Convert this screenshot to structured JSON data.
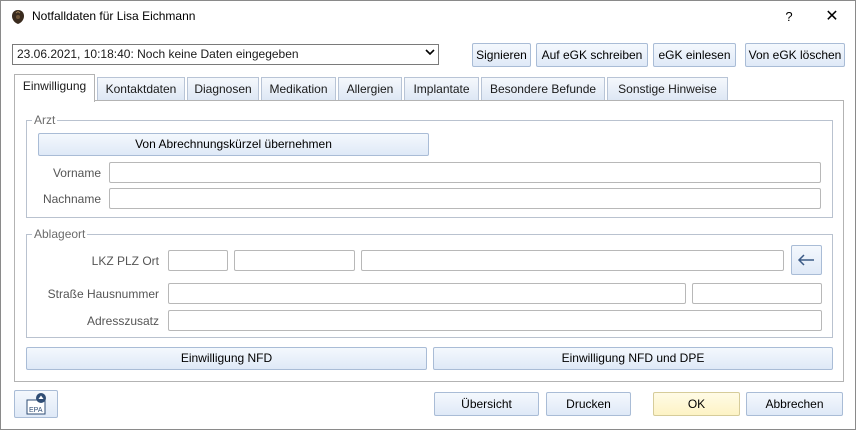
{
  "window": {
    "title": "Notfalldaten für Lisa Eichmann",
    "help": "?",
    "close": "✕"
  },
  "toolbar": {
    "version_select": "23.06.2021, 10:18:40: Noch keine Daten eingegeben",
    "sign": "Signieren",
    "write_egk": "Auf eGK schreiben",
    "read_egk": "eGK einlesen",
    "delete_egk": "Von eGK löschen"
  },
  "tabs": [
    {
      "label": "Einwilligung",
      "active": true
    },
    {
      "label": "Kontaktdaten"
    },
    {
      "label": "Diagnosen"
    },
    {
      "label": "Medikation"
    },
    {
      "label": "Allergien"
    },
    {
      "label": "Implantate"
    },
    {
      "label": "Besondere Befunde"
    },
    {
      "label": "Sonstige Hinweise"
    }
  ],
  "arzt": {
    "title": "Arzt",
    "take_over_button": "Von Abrechnungskürzel übernehmen",
    "first_name_label": "Vorname",
    "first_name_value": "",
    "last_name_label": "Nachname",
    "last_name_value": ""
  },
  "ablageort": {
    "title": "Ablageort",
    "lkz_plz_ort_label": "LKZ PLZ Ort",
    "street_label": "Straße Hausnummer",
    "address_extra_label": "Adresszusatz"
  },
  "consent": {
    "nfd": "Einwilligung NFD",
    "nfd_dpe": "Einwilligung NFD und DPE"
  },
  "footer": {
    "epa_label": "EPA",
    "overview": "Übersicht",
    "print": "Drucken",
    "ok": "OK",
    "cancel": "Abbrechen"
  }
}
